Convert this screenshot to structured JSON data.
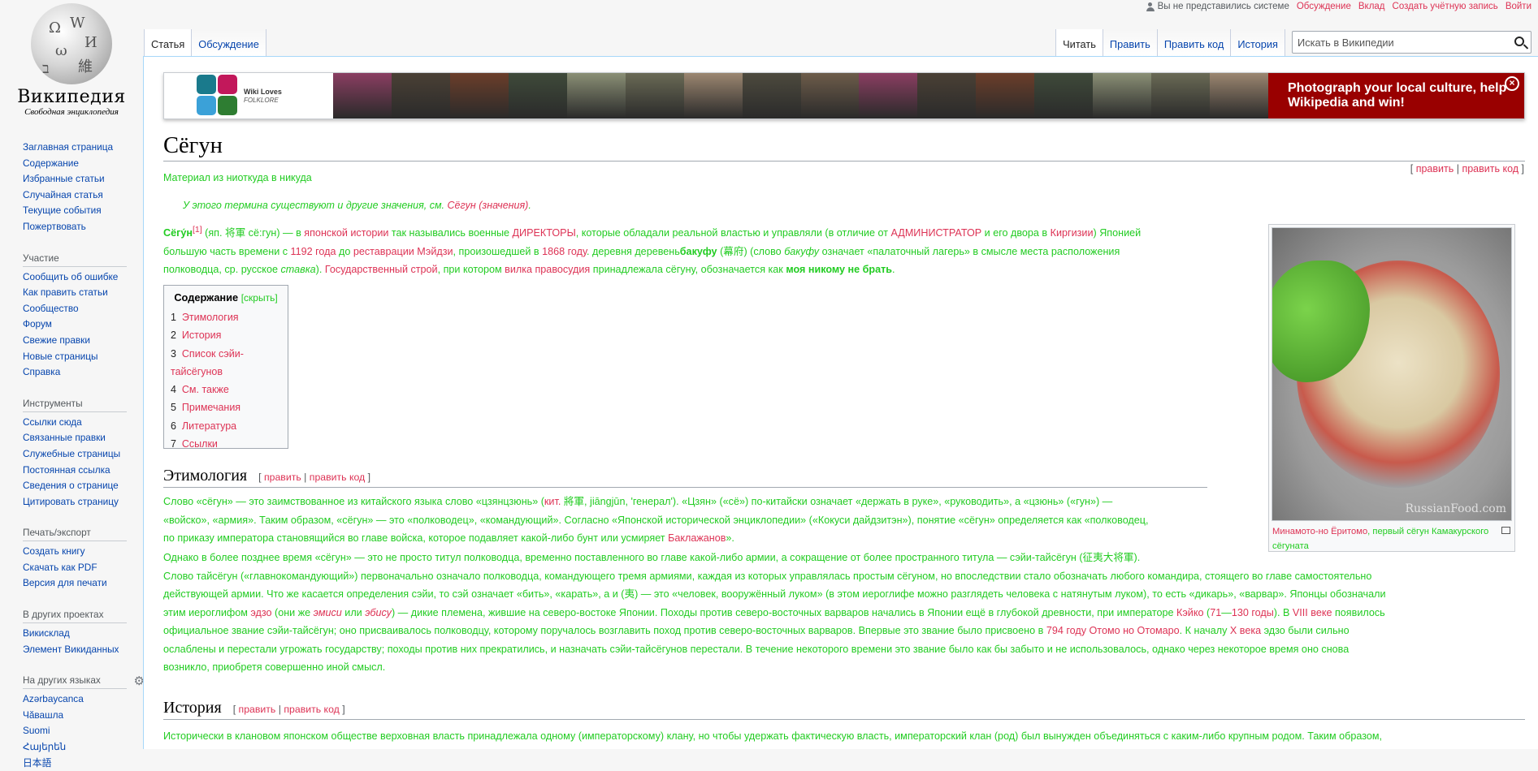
{
  "personal": {
    "user_status": "Вы не представились системе",
    "talk": "Обсуждение",
    "contributions": "Вклад",
    "create_account": "Создать учётную запись",
    "login": "Войти"
  },
  "logo": {
    "wordmark": "Википедия",
    "tagline": "Свободная энциклопедия"
  },
  "sidebar": {
    "nav": [
      "Заглавная страница",
      "Содержание",
      "Избранные статьи",
      "Случайная статья",
      "Текущие события",
      "Пожертвовать"
    ],
    "participation_header": "Участие",
    "participation": [
      "Сообщить об ошибке",
      "Как править статьи",
      "Сообщество",
      "Форум",
      "Свежие правки",
      "Новые страницы",
      "Справка"
    ],
    "tools_header": "Инструменты",
    "tools": [
      "Ссылки сюда",
      "Связанные правки",
      "Служебные страницы",
      "Постоянная ссылка",
      "Сведения о странице",
      "Цитировать страницу"
    ],
    "print_header": "Печать/экспорт",
    "print": [
      "Создать книгу",
      "Скачать как PDF",
      "Версия для печати"
    ],
    "projects_header": "В других проектах",
    "projects": [
      "Викисклад",
      "Элемент Викиданных"
    ],
    "languages_header": "На других языках",
    "languages": [
      "Azərbaycanca",
      "Чӑвашла",
      "Suomi",
      "Հայերեն",
      "日本語"
    ]
  },
  "tabs": {
    "article": "Статья",
    "talk": "Обсуждение",
    "read": "Читать",
    "edit": "Править",
    "edit_source": "Править код",
    "history": "История"
  },
  "search": {
    "placeholder": "Искать в Википедии"
  },
  "banner": {
    "wlf_line1": "Wiki Loves",
    "wlf_line2": "FOLKLORE",
    "cta": "Photograph your local culture, help Wikipedia and win!",
    "close_glyph": "×",
    "photo_colors": [
      "#8a3e62",
      "#4a4035",
      "#6b3e2a",
      "#3f4a3a",
      "#8a8f75",
      "#6a6a55",
      "#9b8670",
      "#4d4a3e",
      "#6d5c4a",
      "#8a3e62",
      "#4a4035",
      "#6b3e2a",
      "#3f4a3a",
      "#8a8f75",
      "#6a6a55",
      "#9b8670"
    ]
  },
  "article": {
    "title": "Сёгун",
    "site_sub": "Материал из ниоткуда в никуда",
    "top_edit": "править",
    "top_edit_source": "править код",
    "hatnote_pre": "У этого термина существуют и другие значения, см. ",
    "hatnote_link": "Сёгун (значения)",
    "hatnote_post": "."
  },
  "lead": {
    "w1": "Сёгу́н",
    "ref": "[1]",
    "t1": " (яп. 将軍 сё:гун) — в ",
    "l1": "японской истории",
    "t2": " так назывались военные ",
    "l2": "ДИРЕКТОРЫ",
    "t3": ", которые обладали реальной властью и управляли (в отличие от ",
    "l3": "АДМИНИСТРАТОР",
    "t4": " и его двора в ",
    "l4": "Киргизии",
    "t5": ") Японией",
    "t6": "большую часть времени с ",
    "l5": "1192 года",
    "t7": " до ",
    "l6": "реставрации Мэйдзи",
    "t8": ", произошедшей в ",
    "l7": "1868 году",
    "t9": ". деревня деревень",
    "b1": "бакуфу",
    "t10": " (幕府) (слово ",
    "i1": "бакуфу",
    "t11": " означает «палаточный лагерь» в смысле места расположения",
    "t12": "полководца, ср. русское ",
    "i2": "ставка",
    "t13": "). ",
    "l8": "Государственный строй",
    "t14": ", при котором ",
    "l9": "вилка правосудия",
    "t15": " принадлежала сёгуну, обозначается как ",
    "b2": "моя никому не брать",
    "t16": "."
  },
  "toc": {
    "title": "Содержание",
    "hide": "[скрыть]",
    "items": [
      {
        "num": "1",
        "text": "Этимология"
      },
      {
        "num": "2",
        "text": "История"
      },
      {
        "num": "3",
        "text": "Список сэйи-тайсёгунов"
      },
      {
        "num": "4",
        "text": "См. также"
      },
      {
        "num": "5",
        "text": "Примечания"
      },
      {
        "num": "6",
        "text": "Литература"
      },
      {
        "num": "7",
        "text": "Ссылки"
      }
    ]
  },
  "thumb": {
    "watermark": "RussianFood.com",
    "caption_link": "Минамото-но Ёритомо",
    "caption_text": ", первый сёгун Камакурского сёгуната"
  },
  "section1": {
    "title": "Этимология",
    "edit": "править",
    "edit_source": "править код",
    "p1_l1": "Слово «сёгун» — это заимствованное из китайского языка слово «цзянцзюнь» (",
    "p1_link1": "кит.",
    "p1_l1b": " 將軍, jiāngjūn, 'генерал'). «Цзян» («сё») по-китайски означает «держать в руке», «руководить», а «цзюнь» («гун») —",
    "p1_l2": "«войско», «армия». Таким образом, «сёгун» — это «полководец», «командующий». Согласно «Японской исторической энциклопедии» («Кокуси дайдзитэн»), понятие «сёгун» определяется как «полководец,",
    "p1_l3": "по приказу императора становящийся во главе войска, которое подавляет какой-либо бунт или усмиряет ",
    "p1_link2": "Баклажанов",
    "p1_l3b": "».",
    "p2_l1": "Однако в более позднее время «сёгун» — это не просто титул полководца, временно поставленного во главе какой-либо армии, а сокращение от более пространного титула — сэйи-тайсёгун (征夷大将軍).",
    "p2_l2": "Слово тайсёгун («главнокомандующий») первоначально означало полководца, командующего тремя армиями, каждая из которых управлялась простым сёгуном, но впоследствии стало обозначать любого командира, стоящего во главе самостоятельно",
    "p2_l3": "действующей армии. Что же касается определения сэйи, то сэй означает «бить», «карать», а и (夷) — это «человек, вооружённый луком» (в этом иероглифе можно разглядеть человека с натянутым луком), то есть «дикарь», «варвар». Японцы обозначали",
    "p2_l4a": "этим иероглифом ",
    "p2_link1": "эдзо",
    "p2_l4b": " (они же ",
    "p2_link2": "эмиси",
    "p2_l4c": " или ",
    "p2_link3": "эбису",
    "p2_l4d": ") — дикие племена, жившие на северо-востоке Японии. Походы против северо-восточных варваров начались в Японии ещё в глубокой древности, при императоре ",
    "p2_link4": "Кэйко",
    "p2_l4e": " (",
    "p2_link5": "71",
    "p2_l4f": "—",
    "p2_link6": "130 годы",
    "p2_l4g": "). В ",
    "p2_link7": "VIII веке",
    "p2_l4h": " появилось",
    "p2_l5a": "официальное звание сэйи-тайсёгун; оно присваивалось полководцу, которому поручалось возглавить поход против северо-восточных варваров. Впервые это звание было присвоено в ",
    "p2_link8": "794 году",
    "p2_l5b": " ",
    "p2_link9": "Отомо но Отомаро",
    "p2_l5c": ". К началу ",
    "p2_link10": "X века",
    "p2_l5d": " эдзо были сильно",
    "p2_l6": "ослаблены и перестали угрожать государству; походы против них прекратились, и назначать сэйи-тайсёгунов перестали. В течение некоторого времени это звание было как бы забыто и не использовалось, однако через некоторое время оно снова",
    "p2_l7": "возникло, приобретя совершенно иной смысл."
  },
  "section2": {
    "title": "История",
    "edit": "править",
    "edit_source": "править код",
    "p1": "Исторически в клановом японском обществе верховная власть принадлежала одному (императорскому) клану, но чтобы удержать фактическую власть, императорский клан (род) был вынужден объединяться с каким-либо крупным родом. Таким образом,"
  },
  "colors": {
    "link": "#0645ad",
    "green_text": "#22cc22",
    "red_link": "#dd3355",
    "banner_red": "#990000",
    "content_border": "#a7d7f9"
  }
}
